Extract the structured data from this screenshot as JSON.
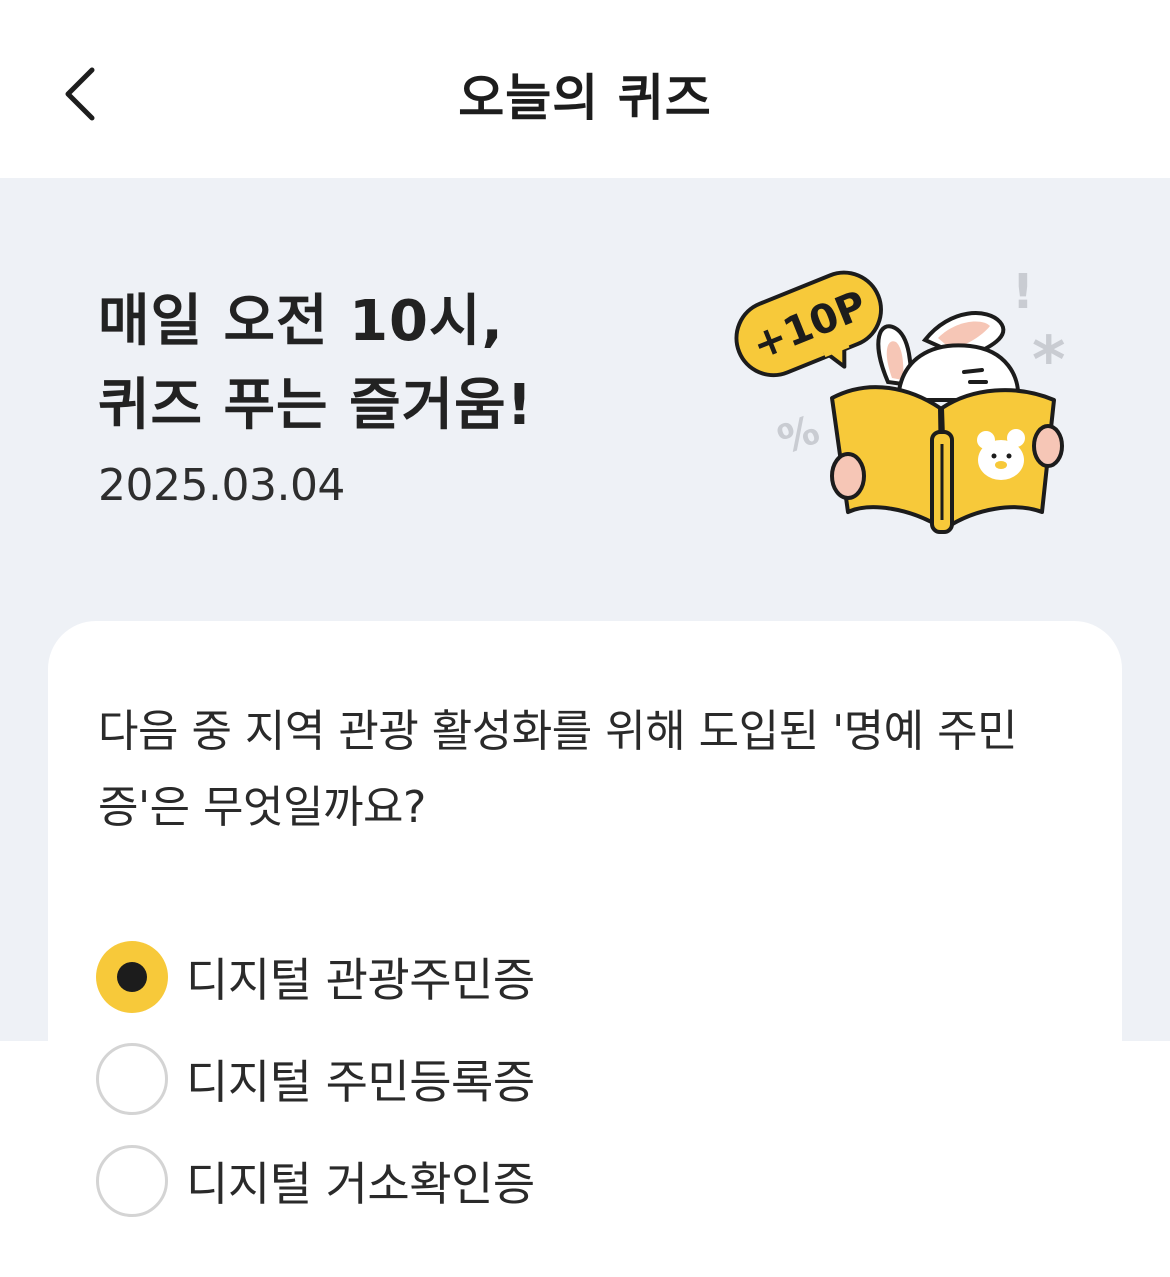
{
  "header": {
    "title": "오늘의 퀴즈",
    "back_icon": "chevron-left-icon"
  },
  "hero": {
    "title_line1": "매일 오전 10시,",
    "title_line2": "퀴즈 푸는 즐거움!",
    "date": "2025.03.04",
    "badge_text": "+10P",
    "exclaim": "!",
    "percent": "%",
    "asterisk": "*"
  },
  "quiz": {
    "question": "다음 중 지역 관광 활성화를 위해 도입된 '명예 주민증'은 무엇일까요?",
    "options": [
      {
        "label": "디지털 관광주민증",
        "selected": true
      },
      {
        "label": "디지털 주민등록증",
        "selected": false
      },
      {
        "label": "디지털 거소확인증",
        "selected": false
      }
    ]
  },
  "colors": {
    "accent": "#f7c93a",
    "hero_bg": "#eef1f6",
    "radio_border": "#d4d4d4"
  }
}
